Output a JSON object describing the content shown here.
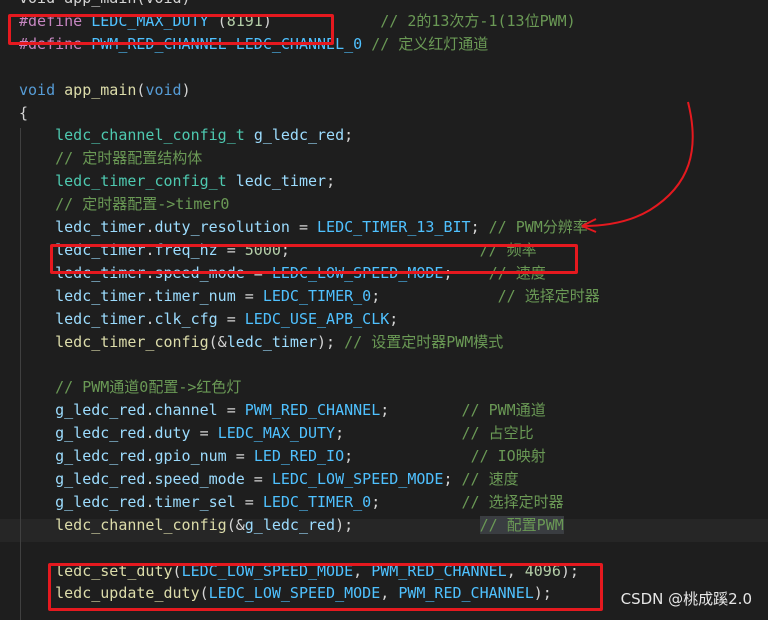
{
  "colors": {
    "keyword": "#569cd6",
    "control": "#c586c0",
    "identifier": "#9cdcfe",
    "function": "#dcdcaa",
    "type": "#4ec9b0",
    "constant": "#4fc1ff",
    "number": "#b5cea8",
    "comment": "#6a9955",
    "text": "#d4d4d4",
    "annotation": "#e5191f"
  },
  "watermark": "CSDN @桃成蹊2.0",
  "code_lines": [
    [
      [
        "text",
        "void app_main(void)"
      ]
    ],
    [
      [
        "control",
        "#define"
      ],
      [
        "text",
        " "
      ],
      [
        "constant",
        "LEDC_MAX_DUTY"
      ],
      [
        "text",
        " ("
      ],
      [
        "number",
        "8191"
      ],
      [
        "text",
        ")            "
      ],
      [
        "comment",
        "// 2的13次方-1(13位PWM)"
      ]
    ],
    [
      [
        "control",
        "#define"
      ],
      [
        "text",
        " "
      ],
      [
        "constant",
        "PWM_RED_CHANNEL"
      ],
      [
        "text",
        " "
      ],
      [
        "constant",
        "LEDC_CHANNEL_0"
      ],
      [
        "text",
        " "
      ],
      [
        "comment",
        "// 定义红灯通道"
      ]
    ],
    [],
    [
      [
        "keyword",
        "void"
      ],
      [
        "text",
        " "
      ],
      [
        "function",
        "app_main"
      ],
      [
        "text",
        "("
      ],
      [
        "keyword",
        "void"
      ],
      [
        "text",
        ")"
      ]
    ],
    [
      [
        "text",
        "{"
      ]
    ],
    [
      [
        "text",
        "    "
      ],
      [
        "type",
        "ledc_channel_config_t"
      ],
      [
        "text",
        " "
      ],
      [
        "identifier",
        "g_ledc_red"
      ],
      [
        "text",
        ";"
      ]
    ],
    [
      [
        "text",
        "    "
      ],
      [
        "comment",
        "// 定时器配置结构体"
      ]
    ],
    [
      [
        "text",
        "    "
      ],
      [
        "type",
        "ledc_timer_config_t"
      ],
      [
        "text",
        " "
      ],
      [
        "identifier",
        "ledc_timer"
      ],
      [
        "text",
        ";"
      ]
    ],
    [
      [
        "text",
        "    "
      ],
      [
        "comment",
        "// 定时器配置->timer0"
      ]
    ],
    [
      [
        "text",
        "    "
      ],
      [
        "identifier",
        "ledc_timer"
      ],
      [
        "text",
        "."
      ],
      [
        "identifier",
        "duty_resolution"
      ],
      [
        "text",
        " = "
      ],
      [
        "constant",
        "LEDC_TIMER_13_BIT"
      ],
      [
        "text",
        "; "
      ],
      [
        "comment",
        "// PWM分辨率"
      ]
    ],
    [
      [
        "text",
        "    "
      ],
      [
        "identifier",
        "ledc_timer"
      ],
      [
        "text",
        "."
      ],
      [
        "identifier",
        "freq_hz"
      ],
      [
        "text",
        " = "
      ],
      [
        "number",
        "5000"
      ],
      [
        "text",
        ";                     "
      ],
      [
        "comment",
        "// 频率"
      ]
    ],
    [
      [
        "text",
        "    "
      ],
      [
        "identifier",
        "ledc_timer"
      ],
      [
        "text",
        "."
      ],
      [
        "identifier",
        "speed_mode"
      ],
      [
        "text",
        " = "
      ],
      [
        "constant",
        "LEDC_LOW_SPEED_MODE"
      ],
      [
        "text",
        ";    "
      ],
      [
        "comment",
        "// 速度"
      ]
    ],
    [
      [
        "text",
        "    "
      ],
      [
        "identifier",
        "ledc_timer"
      ],
      [
        "text",
        "."
      ],
      [
        "identifier",
        "timer_num"
      ],
      [
        "text",
        " = "
      ],
      [
        "constant",
        "LEDC_TIMER_0"
      ],
      [
        "text",
        ";             "
      ],
      [
        "comment",
        "// 选择定时器"
      ]
    ],
    [
      [
        "text",
        "    "
      ],
      [
        "identifier",
        "ledc_timer"
      ],
      [
        "text",
        "."
      ],
      [
        "identifier",
        "clk_cfg"
      ],
      [
        "text",
        " = "
      ],
      [
        "constant",
        "LEDC_USE_APB_CLK"
      ],
      [
        "text",
        ";"
      ]
    ],
    [
      [
        "text",
        "    "
      ],
      [
        "function",
        "ledc_timer_config"
      ],
      [
        "text",
        "(&"
      ],
      [
        "identifier",
        "ledc_timer"
      ],
      [
        "text",
        "); "
      ],
      [
        "comment",
        "// 设置定时器PWM模式"
      ]
    ],
    [],
    [
      [
        "text",
        "    "
      ],
      [
        "comment",
        "// PWM通道0配置->红色灯"
      ]
    ],
    [
      [
        "text",
        "    "
      ],
      [
        "identifier",
        "g_ledc_red"
      ],
      [
        "text",
        "."
      ],
      [
        "identifier",
        "channel"
      ],
      [
        "text",
        " = "
      ],
      [
        "constant",
        "PWM_RED_CHANNEL"
      ],
      [
        "text",
        ";        "
      ],
      [
        "comment",
        "// PWM通道"
      ]
    ],
    [
      [
        "text",
        "    "
      ],
      [
        "identifier",
        "g_ledc_red"
      ],
      [
        "text",
        "."
      ],
      [
        "identifier",
        "duty"
      ],
      [
        "text",
        " = "
      ],
      [
        "constant",
        "LEDC_MAX_DUTY"
      ],
      [
        "text",
        ";             "
      ],
      [
        "comment",
        "// 占空比"
      ]
    ],
    [
      [
        "text",
        "    "
      ],
      [
        "identifier",
        "g_ledc_red"
      ],
      [
        "text",
        "."
      ],
      [
        "identifier",
        "gpio_num"
      ],
      [
        "text",
        " = "
      ],
      [
        "constant",
        "LED_RED_IO"
      ],
      [
        "text",
        ";             "
      ],
      [
        "comment",
        "// IO映射"
      ]
    ],
    [
      [
        "text",
        "    "
      ],
      [
        "identifier",
        "g_ledc_red"
      ],
      [
        "text",
        "."
      ],
      [
        "identifier",
        "speed_mode"
      ],
      [
        "text",
        " = "
      ],
      [
        "constant",
        "LEDC_LOW_SPEED_MODE"
      ],
      [
        "text",
        "; "
      ],
      [
        "comment",
        "// 速度"
      ]
    ],
    [
      [
        "text",
        "    "
      ],
      [
        "identifier",
        "g_ledc_red"
      ],
      [
        "text",
        "."
      ],
      [
        "identifier",
        "timer_sel"
      ],
      [
        "text",
        " = "
      ],
      [
        "constant",
        "LEDC_TIMER_0"
      ],
      [
        "text",
        ";         "
      ],
      [
        "comment",
        "// 选择定时器"
      ]
    ],
    [
      [
        "text",
        "    "
      ],
      [
        "function",
        "ledc_channel_config"
      ],
      [
        "text",
        "(&"
      ],
      [
        "identifier",
        "g_ledc_red"
      ],
      [
        "text",
        ");              "
      ],
      [
        "comment",
        "// 配置PWM"
      ]
    ],
    [],
    [
      [
        "text",
        "    "
      ],
      [
        "function",
        "ledc_set_duty"
      ],
      [
        "text",
        "("
      ],
      [
        "constant",
        "LEDC_LOW_SPEED_MODE"
      ],
      [
        "text",
        ", "
      ],
      [
        "constant",
        "PWM_RED_CHANNEL"
      ],
      [
        "text",
        ", "
      ],
      [
        "number",
        "4096"
      ],
      [
        "text",
        ");"
      ]
    ],
    [
      [
        "text",
        "    "
      ],
      [
        "function",
        "ledc_update_duty"
      ],
      [
        "text",
        "("
      ],
      [
        "constant",
        "LEDC_LOW_SPEED_MODE"
      ],
      [
        "text",
        ", "
      ],
      [
        "constant",
        "PWM_RED_CHANNEL"
      ],
      [
        "text",
        ");"
      ]
    ]
  ]
}
